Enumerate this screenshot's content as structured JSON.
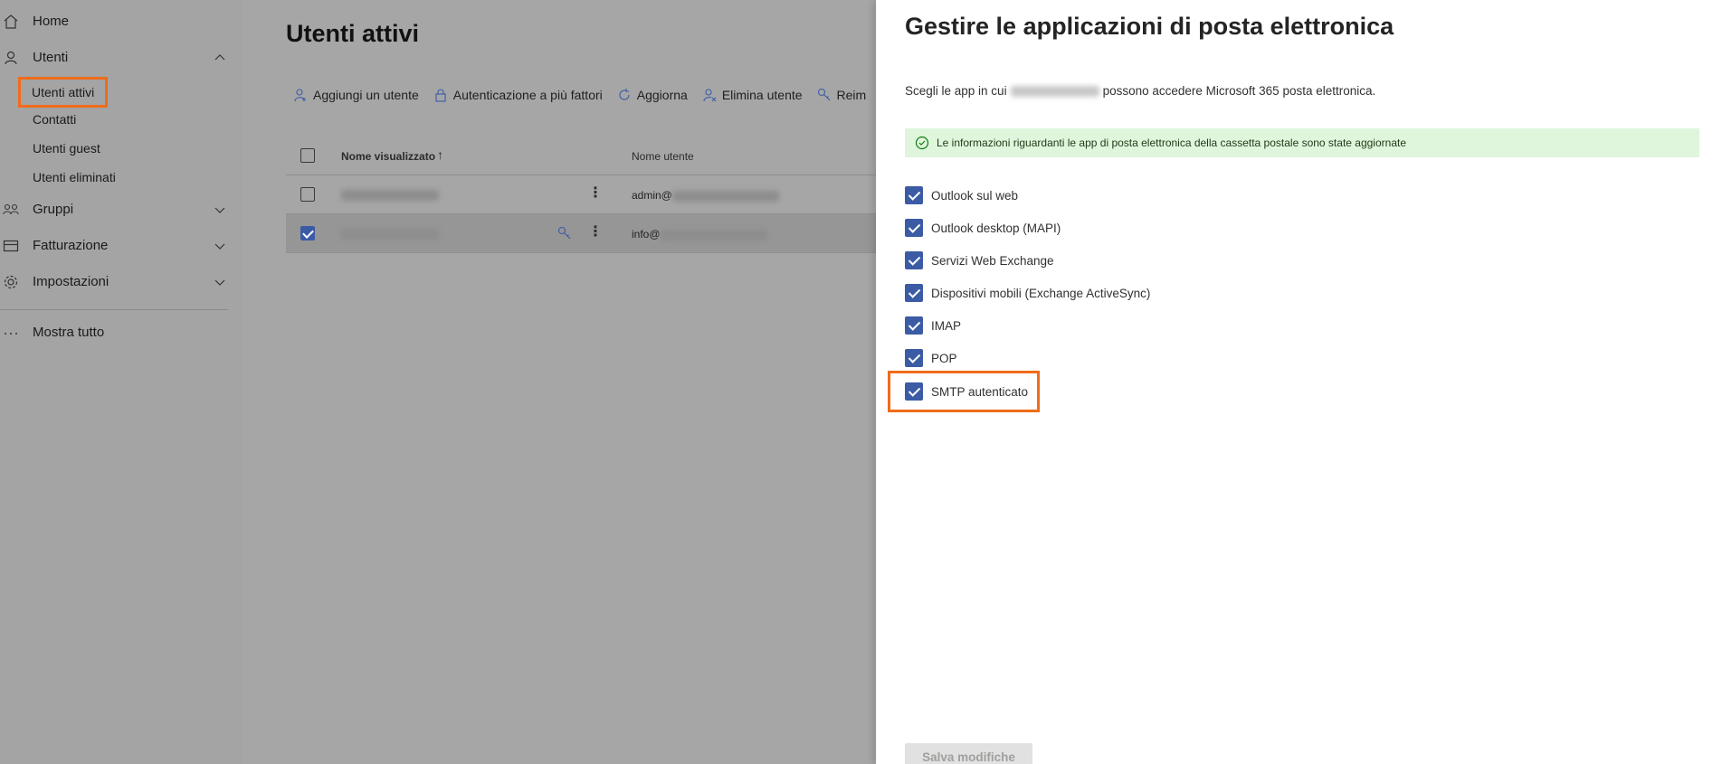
{
  "sidebar": {
    "items": [
      {
        "label": "Home",
        "icon": "home-icon"
      },
      {
        "label": "Utenti",
        "icon": "person-icon"
      },
      {
        "label": "Gruppi",
        "icon": "group-icon"
      },
      {
        "label": "Fatturazione",
        "icon": "card-icon"
      },
      {
        "label": "Impostazioni",
        "icon": "gear-icon"
      },
      {
        "label": "Mostra tutto",
        "icon": "more-icon"
      }
    ],
    "subitems": [
      "Utenti attivi",
      "Contatti",
      "Utenti guest",
      "Utenti eliminati"
    ],
    "highlight_color": "#ef6c1a"
  },
  "main": {
    "title": "Utenti attivi",
    "commands": [
      "Aggiungi un utente",
      "Autenticazione a più fattori",
      "Aggiorna",
      "Elimina utente",
      "Reim"
    ],
    "columns": {
      "display_name": "Nome visualizzato",
      "username": "Nome utente"
    },
    "rows": [
      {
        "username_prefix": "admin@",
        "selected": false
      },
      {
        "username_prefix": "info@",
        "selected": true
      }
    ]
  },
  "panel": {
    "title": "Gestire le applicazioni di posta elettronica",
    "desc_before": "Scegli le app in cui",
    "desc_after": "possono accedere Microsoft 365 posta elettronica.",
    "banner": "Le informazioni riguardanti le app di posta elettronica della cassetta postale sono state aggiornate",
    "options": [
      "Outlook sul web",
      "Outlook desktop (MAPI)",
      "Servizi Web Exchange",
      "Dispositivi mobili (Exchange ActiveSync)",
      "IMAP",
      "POP",
      "SMTP autenticato"
    ],
    "save_label": "Salva modifiche",
    "accent_color": "#3b5ba5"
  }
}
